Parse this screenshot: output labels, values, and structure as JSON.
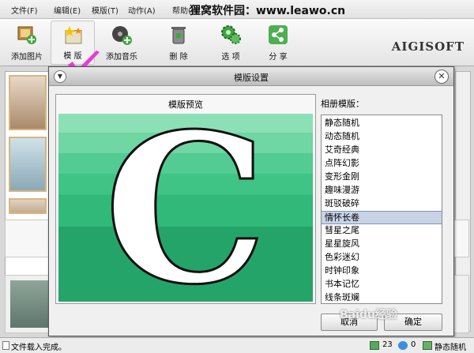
{
  "menu": {
    "items": [
      "文件(F)",
      "编辑(E)",
      "模版(T)",
      "动作(A)",
      "帮助(H)"
    ],
    "banner": "狸窝软件园：www.leawo.cn"
  },
  "toolbar": {
    "add_photo": "添加图片",
    "template": "模 版",
    "add_music": "添加音乐",
    "delete": "删 除",
    "options": "选 项",
    "share": "分 享",
    "logo": "AIGISOFT"
  },
  "dialog": {
    "title": "模版设置",
    "preview_label": "模版预览",
    "preview_letter": "C",
    "list_label": "相册模版：",
    "templates": [
      "静态随机",
      "动态随机",
      "艾奇经典",
      "点阵幻影",
      "变形金刚",
      "趣味漫游",
      "斑驳破碎",
      "情怀长卷",
      "彗星之尾",
      "星星旋风",
      "色彩迷幻",
      "时钟印象",
      "书本记忆",
      "线条斑斓"
    ],
    "selected_index": 7,
    "cancel": "取消",
    "ok": "确定"
  },
  "watermark": "Baidu经验",
  "status": {
    "text": "文件载入完成。",
    "photo_count": "23",
    "music_count": "0",
    "mode": "静态随机"
  },
  "colors": {
    "accent": "#2fb777",
    "checkmark": "#e83cd4",
    "selection": "#c8d3e6"
  }
}
